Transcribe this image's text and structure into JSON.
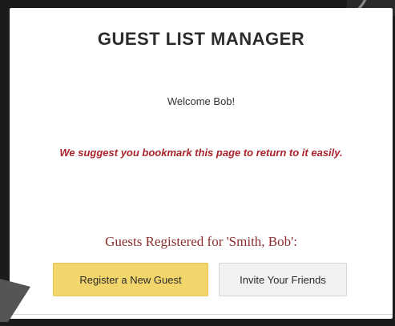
{
  "header": {
    "title": "GUEST LIST MANAGER"
  },
  "main": {
    "welcome_text": "Welcome Bob!",
    "bookmark_notice": "We suggest you bookmark this page to return to it easily.",
    "guests_heading": "Guests Registered for 'Smith, Bob':"
  },
  "actions": {
    "register_label": "Register a New Guest",
    "invite_label": "Invite Your Friends"
  },
  "colors": {
    "register_button_bg": "#f2d66c",
    "invite_button_bg": "#f1f1f1",
    "notice_text": "#a8232c",
    "heading_text": "#8b2e2e"
  },
  "icons": {
    "pointer": "mouse-cursor-icon"
  }
}
